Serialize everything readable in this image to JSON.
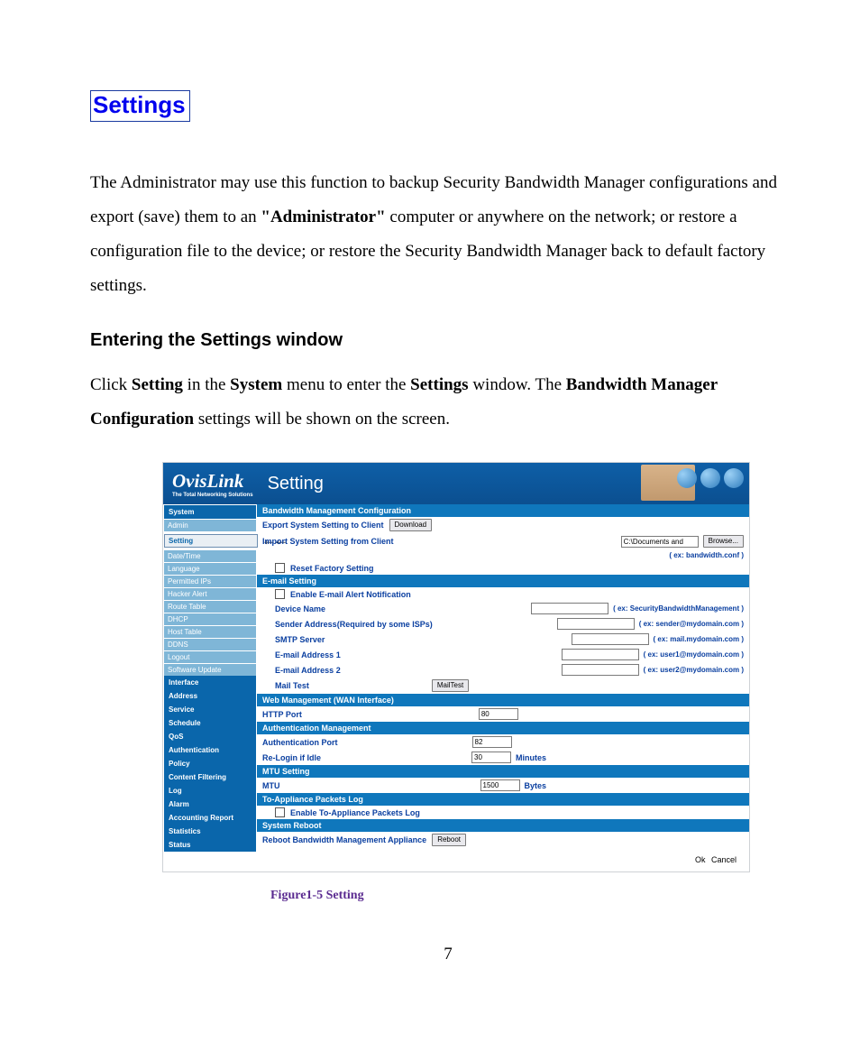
{
  "page_title": "Settings",
  "intro_parts": {
    "p1": "The Administrator may use this function to backup Security Bandwidth Manager configurations and export (save) them to an ",
    "bold1": "\"Administrator\"",
    "p2": " computer or anywhere on the network; or restore a configuration file to the device; or restore the Security Bandwidth Manager back to default factory settings."
  },
  "section_heading": "Entering the Settings window",
  "entering_parts": {
    "a": "Click ",
    "b": "Setting",
    "c": " in the ",
    "d": "System",
    "e": " menu to enter the ",
    "f": "Settings",
    "g": " window. The ",
    "h": "Bandwidth Manager Configuration",
    "i": " settings will be shown on the screen."
  },
  "figure_caption": "Figure1-5 Setting",
  "page_number": "7",
  "app": {
    "brand": "OvisLink",
    "brand_sub": "The Total Networking Solutions",
    "title": "Setting",
    "nav": [
      {
        "group": "System",
        "items": [
          "Admin",
          "Setting",
          "Date/Time",
          "Language",
          "Permitted IPs",
          "Hacker Alert",
          "Route Table",
          "DHCP",
          "Host Table",
          "DDNS",
          "Logout",
          "Software Update"
        ],
        "selected": "Setting"
      },
      {
        "group": "Interface",
        "items": []
      },
      {
        "group": "Address",
        "items": []
      },
      {
        "group": "Service",
        "items": []
      },
      {
        "group": "Schedule",
        "items": []
      },
      {
        "group": "QoS",
        "items": []
      },
      {
        "group": "Authentication",
        "items": []
      },
      {
        "group": "Policy",
        "items": []
      },
      {
        "group": "Content Filtering",
        "items": []
      },
      {
        "group": "Log",
        "items": []
      },
      {
        "group": "Alarm",
        "items": []
      },
      {
        "group": "Accounting Report",
        "items": []
      },
      {
        "group": "Statistics",
        "items": []
      },
      {
        "group": "Status",
        "items": []
      }
    ],
    "bandwidth": {
      "header": "Bandwidth Management Configuration",
      "export_label": "Export System Setting to Client",
      "download_btn": "Download",
      "import_label": "Import System Setting from Client",
      "import_value": "C:\\Documents and",
      "browse_btn": "Browse...",
      "import_hint": "( ex: bandwidth.conf )",
      "reset_label": "Reset Factory Setting"
    },
    "email": {
      "header": "E-mail Setting",
      "enable_label": "Enable E-mail Alert Notification",
      "device_name": "Device Name",
      "device_hint": "( ex: SecurityBandwidthManagement )",
      "sender": "Sender Address(Required by some ISPs)",
      "sender_hint": "( ex: sender@mydomain.com )",
      "smtp": "SMTP Server",
      "smtp_hint": "( ex: mail.mydomain.com )",
      "addr1": "E-mail Address 1",
      "addr1_hint": "( ex: user1@mydomain.com )",
      "addr2": "E-mail Address 2",
      "addr2_hint": "( ex: user2@mydomain.com )",
      "mailtest": "Mail Test",
      "mailtest_btn": "MailTest"
    },
    "web": {
      "header": "Web Management (WAN Interface)",
      "http_port_label": "HTTP Port",
      "http_port": "80"
    },
    "auth": {
      "header": "Authentication Management",
      "port_label": "Authentication Port",
      "port": "82",
      "relogin_label": "Re-Login if Idle",
      "relogin": "30",
      "minutes": "Minutes"
    },
    "mtu": {
      "header": "MTU Setting",
      "label": "MTU",
      "value": "1500",
      "unit": "Bytes"
    },
    "pktlog": {
      "header": "To-Appliance Packets Log",
      "enable_label": "Enable To-Appliance Packets Log"
    },
    "reboot": {
      "header": "System Reboot",
      "label": "Reboot Bandwidth Management Appliance",
      "btn": "Reboot"
    },
    "ok": "Ok",
    "cancel": "Cancel"
  }
}
